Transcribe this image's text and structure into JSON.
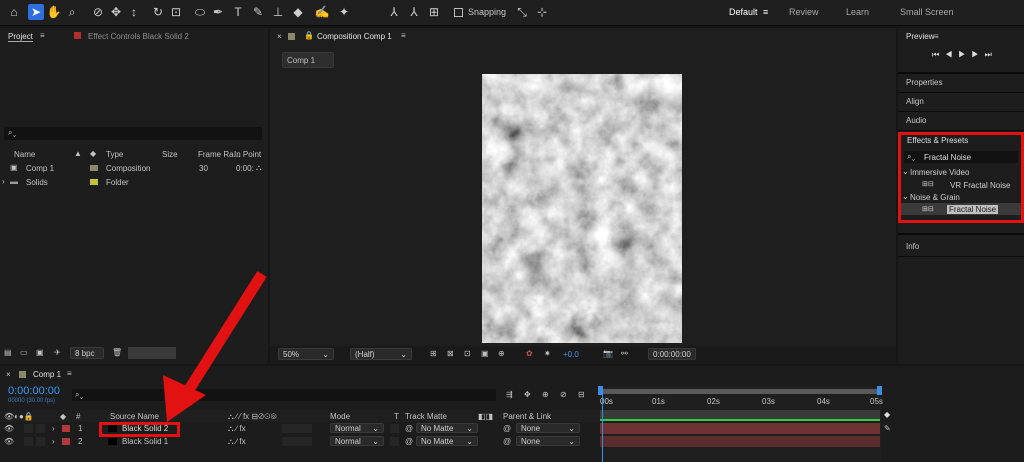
{
  "toolbar": {
    "snapping": "Snapping",
    "workspaces": [
      "Default",
      "Review",
      "Learn",
      "Small Screen"
    ]
  },
  "project_panel": {
    "tabs": [
      "Project",
      "Effect Controls Black Solid 2"
    ],
    "columns": [
      "Name",
      "Type",
      "Size",
      "Frame Ra...",
      "In Point"
    ],
    "items": [
      {
        "name": "Comp 1",
        "type": "Composition",
        "fps": "30",
        "in": "0:00:"
      },
      {
        "name": "Solids",
        "type": "Folder"
      }
    ],
    "bpc": "8 bpc"
  },
  "comp_panel": {
    "tab": "Composition Comp 1",
    "subtab": "Comp 1",
    "zoom": "50%",
    "resolution": "(Half)",
    "exposure": "+0.0",
    "timecode": "0:00:00:00"
  },
  "right_panel": {
    "preview": "Preview",
    "sections": [
      "Properties",
      "Align",
      "Audio"
    ],
    "effects_title": "Effects & Presets",
    "search": "Fractal Noise",
    "groups": [
      {
        "name": "Immersive Video",
        "item": "VR Fractal Noise"
      },
      {
        "name": "Noise & Grain",
        "item": "Fractal Noise"
      }
    ],
    "info": "Info"
  },
  "timeline": {
    "tab": "Comp 1",
    "timecode": "0:00:00:00",
    "fps": "00000 (30.00 fps)",
    "headers": {
      "num": "#",
      "source": "Source Name",
      "mode": "Mode",
      "t": "T",
      "track_matte": "Track Matte",
      "parent": "Parent & Link"
    },
    "layers": [
      {
        "num": "1",
        "name": "Black Solid 2",
        "mode": "Normal",
        "matte": "No Matte",
        "parent": "None"
      },
      {
        "num": "2",
        "name": "Black Solid 1",
        "mode": "Normal",
        "matte": "No Matte",
        "parent": "None"
      }
    ],
    "ruler": [
      "00s",
      "01s",
      "02s",
      "03s",
      "04s",
      "05s"
    ]
  },
  "colors": {
    "accent": "#2f8fe8",
    "highlight_red": "#e31212",
    "layer_label": "#b33a3a"
  }
}
